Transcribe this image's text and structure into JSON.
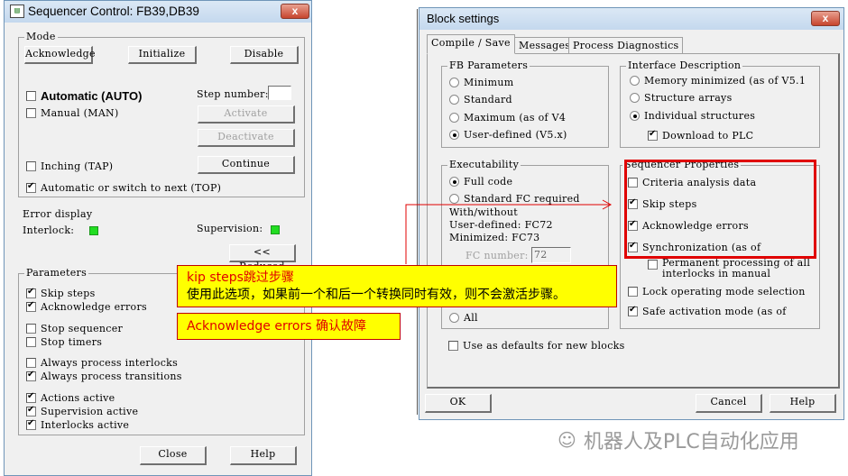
{
  "seq_window": {
    "title": "Sequencer Control: FB39,DB39",
    "close_label": "x",
    "mode": {
      "label": "Mode",
      "acknowledge": "Acknowledge",
      "initialize": "Initialize",
      "disable": "Disable",
      "automatic": {
        "label": "Automatic (AUTO)",
        "checked": false
      },
      "manual": {
        "label": "Manual (MAN)",
        "checked": false
      },
      "step_number_label": "Step number:",
      "step_number_value": "",
      "activate": "Activate",
      "deactivate": "Deactivate",
      "inching": {
        "label": "Inching (TAP)",
        "checked": false
      },
      "continue": "Continue",
      "top": {
        "label": "Automatic or switch to next (TOP)",
        "checked": true
      }
    },
    "error_display": {
      "label": "Error display",
      "interlock_label": "Interlock:",
      "supervision_label": "Supervision:",
      "led_color": "#22dd22"
    },
    "reduced_label": "<< Reduced",
    "parameters": {
      "label": "Parameters",
      "items": [
        {
          "label": "Skip steps",
          "checked": true
        },
        {
          "label": "Acknowledge errors",
          "checked": true
        },
        {
          "label": "Stop sequencer",
          "checked": false
        },
        {
          "label": "Stop timers",
          "checked": false
        },
        {
          "label": "Always process interlocks",
          "checked": false
        },
        {
          "label": "Always process transitions",
          "checked": true
        },
        {
          "label": "Actions active",
          "checked": true
        },
        {
          "label": "Supervision active",
          "checked": true
        },
        {
          "label": "Interlocks active",
          "checked": true
        }
      ]
    },
    "close_button": "Close",
    "help_button": "Help"
  },
  "block_window": {
    "title": "Block settings",
    "close_label": "x",
    "tabs": [
      "Compile / Save",
      "Messages",
      "Process Diagnostics"
    ],
    "fb_parameters": {
      "label": "FB Parameters",
      "options": [
        {
          "label": "Minimum",
          "selected": false
        },
        {
          "label": "Standard",
          "selected": false
        },
        {
          "label": "Maximum (as of V4",
          "selected": false
        },
        {
          "label": "User-defined (V5.x)",
          "selected": true
        }
      ]
    },
    "interface_description": {
      "label": "Interface Description",
      "options": [
        {
          "label": "Memory minimized (as of V5.1",
          "selected": false
        },
        {
          "label": "Structure arrays",
          "selected": false
        },
        {
          "label": "Individual structures",
          "selected": true
        }
      ],
      "download": {
        "label": "Download to PLC",
        "checked": true
      }
    },
    "executability": {
      "label": "Executability",
      "full_code": {
        "label": "Full code",
        "selected": true
      },
      "standard_fc": {
        "label": "Standard FC required",
        "selected": false
      },
      "info_lines": [
        "With/without",
        "User-defined: FC72",
        "Minimized: FC73"
      ],
      "fc_number_label": "FC number:",
      "fc_number_value": "72",
      "all": {
        "label": "All",
        "selected": false
      }
    },
    "sequencer_properties": {
      "label": "Sequencer Properties",
      "items": [
        {
          "label": "Criteria analysis data",
          "checked": false
        },
        {
          "label": "Skip steps",
          "checked": true
        },
        {
          "label": "Acknowledge errors",
          "checked": true
        },
        {
          "label": "Synchronization (as of",
          "checked": true
        }
      ],
      "permanent_line1": "Permanent processing of all",
      "permanent_line2": "interlocks in manual",
      "lock": {
        "label": "Lock operating mode selection",
        "checked": false
      },
      "safe": {
        "label": "Safe activation mode (as of",
        "checked": true
      }
    },
    "use_defaults": {
      "label": "Use as defaults for new blocks",
      "checked": false
    },
    "ok": "OK",
    "cancel": "Cancel",
    "help": "Help"
  },
  "callouts": {
    "skip_title": "kip steps跳过步骤",
    "skip_body": "使用此选项，如果前一个和后一个转换同时有效，则不会激活步骤。",
    "ack": "Acknowledge errors  确认故障"
  },
  "watermark": "机器人及PLC自动化应用"
}
